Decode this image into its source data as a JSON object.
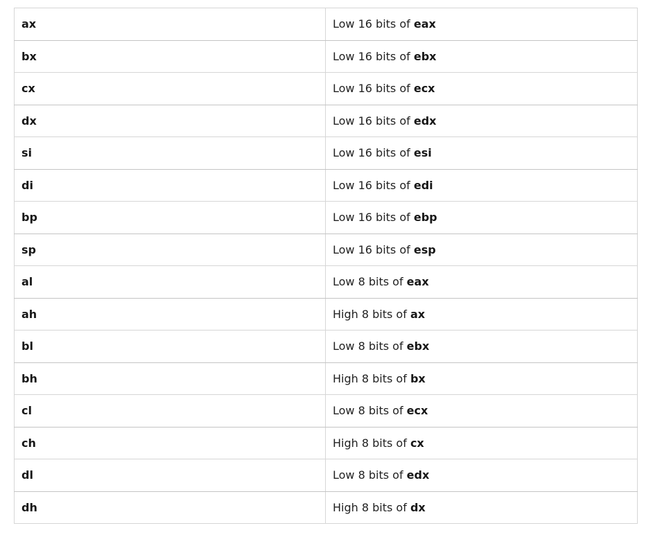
{
  "rows": [
    {
      "reg": "ax",
      "desc": "Low 16 bits of ",
      "src": "eax"
    },
    {
      "reg": "bx",
      "desc": "Low 16 bits of ",
      "src": "ebx"
    },
    {
      "reg": "cx",
      "desc": "Low 16 bits of ",
      "src": "ecx"
    },
    {
      "reg": "dx",
      "desc": "Low 16 bits of ",
      "src": "edx"
    },
    {
      "reg": "si",
      "desc": "Low 16 bits of ",
      "src": "esi"
    },
    {
      "reg": "di",
      "desc": "Low 16 bits of ",
      "src": "edi"
    },
    {
      "reg": "bp",
      "desc": "Low 16 bits of ",
      "src": "ebp"
    },
    {
      "reg": "sp",
      "desc": "Low 16 bits of ",
      "src": "esp"
    },
    {
      "reg": "al",
      "desc": "Low 8 bits of ",
      "src": "eax"
    },
    {
      "reg": "ah",
      "desc": "High 8 bits of ",
      "src": "ax"
    },
    {
      "reg": "bl",
      "desc": "Low 8 bits of ",
      "src": "ebx"
    },
    {
      "reg": "bh",
      "desc": "High 8 bits of ",
      "src": "bx"
    },
    {
      "reg": "cl",
      "desc": "Low 8 bits of ",
      "src": "ecx"
    },
    {
      "reg": "ch",
      "desc": "High 8 bits of ",
      "src": "cx"
    },
    {
      "reg": "dl",
      "desc": "Low 8 bits of ",
      "src": "edx"
    },
    {
      "reg": "dh",
      "desc": "High 8 bits of ",
      "src": "dx"
    }
  ]
}
